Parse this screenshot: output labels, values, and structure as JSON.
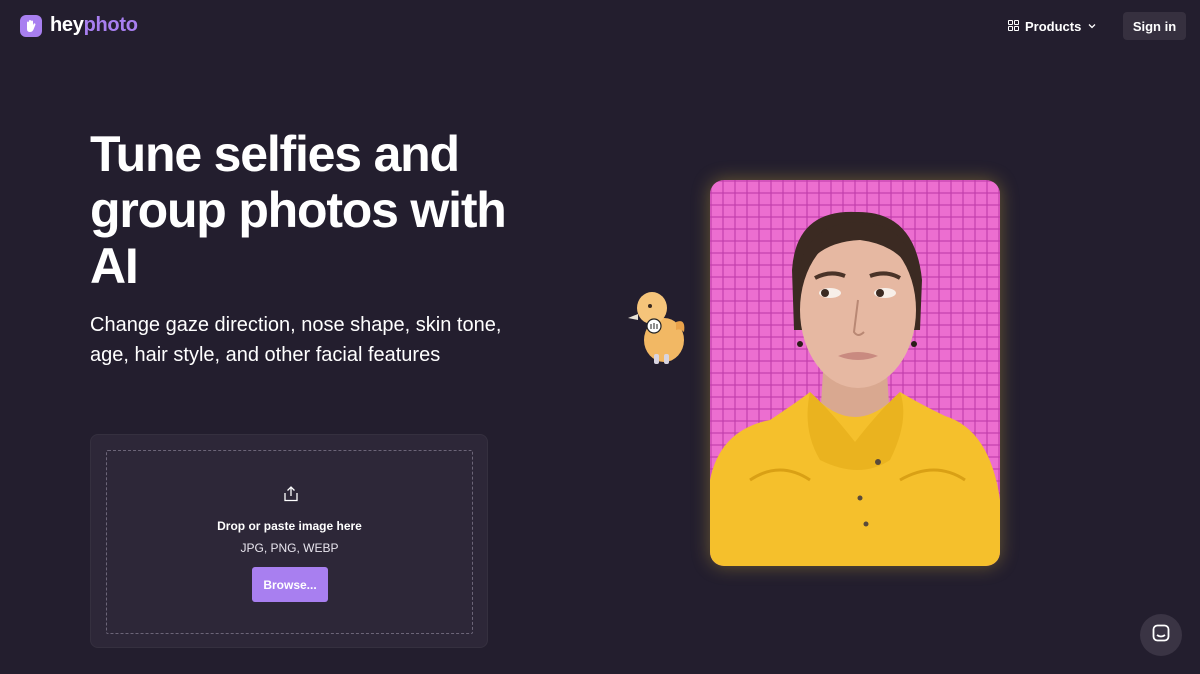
{
  "header": {
    "logo": {
      "prefix": "hey",
      "suffix": "photo"
    },
    "products_label": "Products",
    "signin_label": "Sign in"
  },
  "hero": {
    "title": "Tune selfies and group photos with AI",
    "subtitle": "Change gaze direction, nose shape, skin tone, age, hair style, and other facial features"
  },
  "upload": {
    "drop_text": "Drop or paste image here",
    "formats": "JPG, PNG, WEBP",
    "browse_label": "Browse..."
  },
  "colors": {
    "background": "#231e2e",
    "accent": "#a87ff0",
    "card": "#2d2738",
    "photo_bg": "#ec6ed0",
    "jacket": "#f5c02c"
  },
  "icons": [
    "hand-logo-icon",
    "grid-icon",
    "chevron-down-icon",
    "upload-icon",
    "chat-icon"
  ]
}
